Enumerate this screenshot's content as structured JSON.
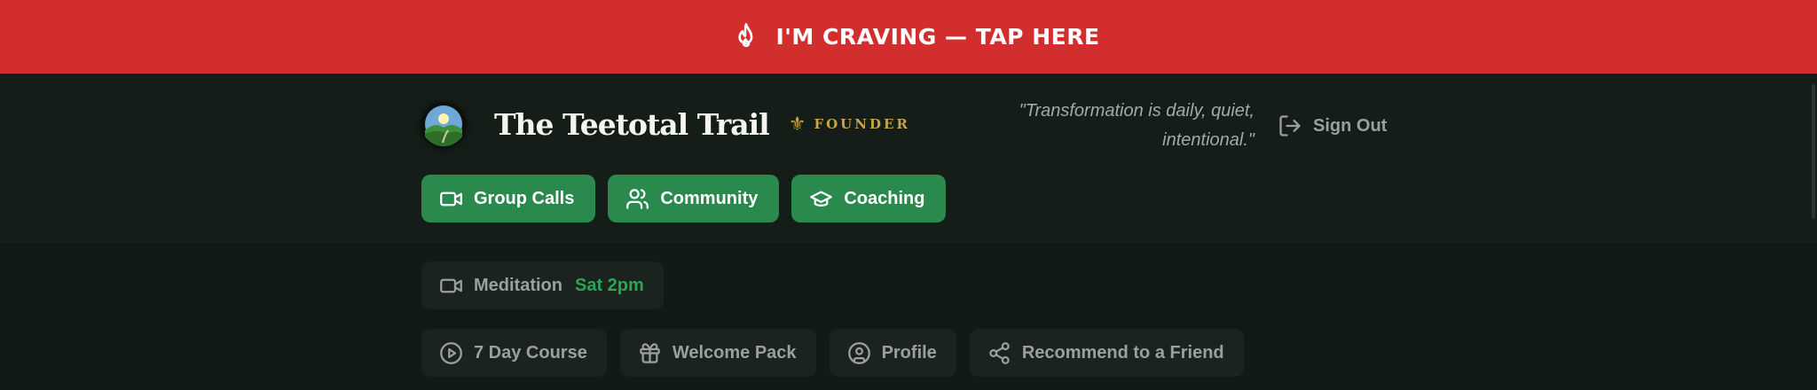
{
  "craving_banner": {
    "icon": "flame-icon",
    "label": "I'M CRAVING — TAP HERE",
    "color": "#d32e2e"
  },
  "header": {
    "logo_icon": "landscape-logo",
    "title": "The Teetotal Trail",
    "badge": {
      "icon": "fleur-de-lis-icon",
      "label": "FOUNDER",
      "color": "#c9a24a"
    },
    "quote_line1": "\"Transformation is daily, quiet,",
    "quote_line2": "intentional.\"",
    "sign_out": {
      "icon": "log-out-icon",
      "label": "Sign Out"
    }
  },
  "primary_nav": [
    {
      "icon": "video-camera-icon",
      "label": "Group Calls"
    },
    {
      "icon": "users-icon",
      "label": "Community"
    },
    {
      "icon": "graduation-cap-icon",
      "label": "Coaching"
    }
  ],
  "accent_color": "#2a8a4e",
  "next_meeting": {
    "icon": "video-camera-icon",
    "label": "Meditation",
    "time": "Sat 2pm"
  },
  "secondary_nav": [
    {
      "icon": "play-circle-icon",
      "label": "7 Day Course"
    },
    {
      "icon": "gift-icon",
      "label": "Welcome Pack"
    },
    {
      "icon": "user-circle-icon",
      "label": "Profile"
    },
    {
      "icon": "share-icon",
      "label": "Recommend to a Friend"
    }
  ]
}
